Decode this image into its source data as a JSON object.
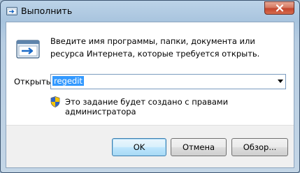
{
  "window": {
    "title": "Выполнить",
    "description": "Введите имя программы, папки, документа или ресурса Интернета, которые требуется открыть.",
    "open_label": "Открыть:",
    "input_value": "regedit",
    "admin_note": "Это задание будет создано с правами администратора"
  },
  "buttons": {
    "ok": "OK",
    "cancel": "Отмена",
    "browse": "Обзор..."
  },
  "icons": {
    "title": "run-app-icon",
    "main": "run-program-icon",
    "close": "close-icon",
    "dropdown": "chevron-down-icon",
    "admin": "uac-shield-icon"
  },
  "colors": {
    "selection": "#3399ff",
    "close_button": "#c4462e",
    "accent_border": "#3c7fb1"
  }
}
